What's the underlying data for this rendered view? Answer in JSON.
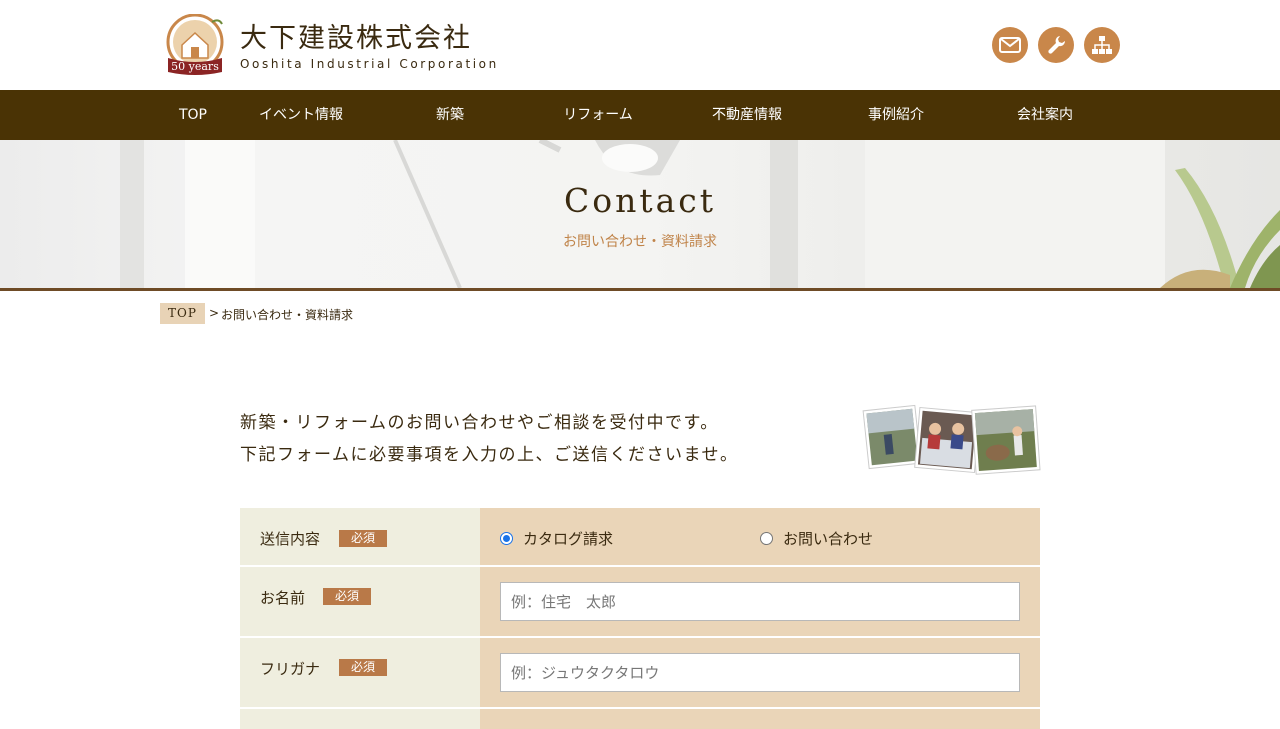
{
  "header": {
    "company_name": "大下建設株式会社",
    "company_en": "Ooshita Industrial Corporation",
    "logo_badge": "50 years",
    "icons": [
      "mail-icon",
      "wrench-icon",
      "sitemap-icon"
    ],
    "accent_color": "#c9874a"
  },
  "nav": {
    "items": [
      "TOP",
      "イベント情報",
      "新築",
      "リフォーム",
      "不動産情報",
      "事例紹介",
      "会社案内"
    ],
    "background": "#4a3305"
  },
  "hero": {
    "title": "Contact",
    "subtitle": "お問い合わせ・資料請求"
  },
  "breadcrumb": {
    "top": "TOP",
    "separator": ">",
    "current": "お問い合わせ・資料請求"
  },
  "intro": {
    "line1": "新築・リフォームのお問い合わせやご相談を受付中です。",
    "line2": "下記フォームに必要事項を入力の上、ご送信くださいませ。"
  },
  "form": {
    "required_label": "必須",
    "send_type": {
      "label": "送信内容",
      "options": [
        "カタログ請求",
        "お問い合わせ"
      ],
      "selected": "カタログ請求"
    },
    "name": {
      "label": "お名前",
      "placeholder": "例：住宅　太郎"
    },
    "kana": {
      "label": "フリガナ",
      "placeholder": "例：ジュウタクタロウ"
    }
  }
}
